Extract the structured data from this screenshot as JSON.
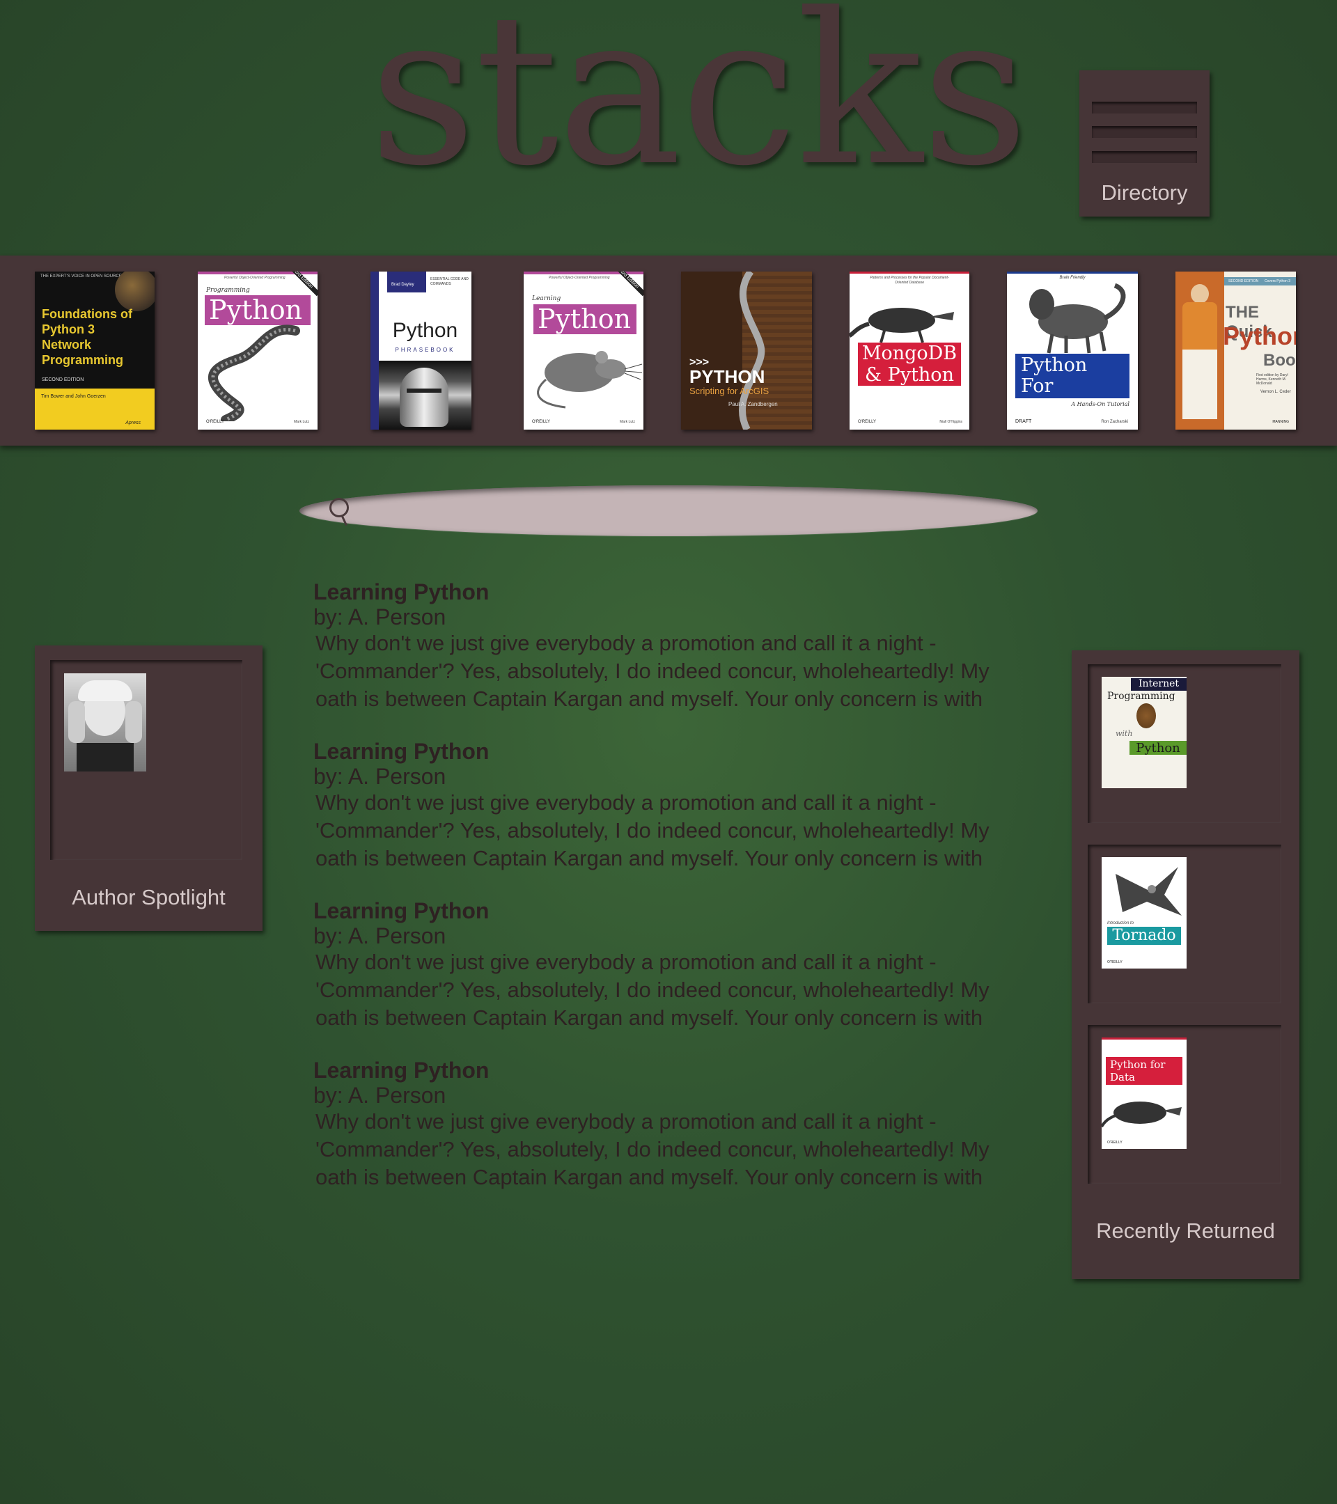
{
  "header": {
    "logo": "stacks",
    "directory_label": "Directory"
  },
  "shelf": {
    "books": [
      {
        "top": "THE EXPERT'S VOICE IN OPEN SOURCE",
        "title": "Foundations of Python 3 Network Programming",
        "edition": "SECOND EDITION",
        "authors": "Tim Bower and John Goerzen",
        "publisher": "Apress"
      },
      {
        "series": "Powerful Object-Oriented Programming",
        "pre": "Programming",
        "title": "Python",
        "badge": "3rd Edition",
        "publisher": "O'REILLY",
        "author": "Mark Lutz"
      },
      {
        "author": "Brad Dayley",
        "tag": "ESSENTIAL CODE AND COMMANDS",
        "title": "Python",
        "subtitle": "PHRASEBOOK"
      },
      {
        "series": "Powerful Object-Oriented Programming",
        "pre": "Learning",
        "title": "Python",
        "badge": "3rd Edition",
        "publisher": "O'REILLY",
        "author": "Mark Lutz"
      },
      {
        "prompt": ">>>",
        "title": "PYTHON",
        "subtitle": "Scripting for ArcGIS",
        "author": "Paul A. Zandbergen"
      },
      {
        "series": "Patterns and Processes for the Popular Document-Oriented Database",
        "title": "MongoDB & Python",
        "publisher": "O'REILLY",
        "author": "Niall O'Higgins"
      },
      {
        "series": "Brain Friendly",
        "title": "Python For Linguists",
        "subtitle": "A Hands-On Tutorial",
        "tag": "DRAFT",
        "author": "Ron Zacharski"
      },
      {
        "series": "SECOND EDITION",
        "series2": "Covers Python 3",
        "pre": "THE Quick",
        "title": "Python",
        "post": "Book",
        "credits": "First edition by Daryl Harms, Kenneth M. McDonald",
        "author": "Vernon L. Ceder",
        "publisher": "MANNING"
      }
    ]
  },
  "search": {
    "placeholder": ""
  },
  "results": [
    {
      "title": "Learning Python",
      "author": "by: A. Person",
      "excerpt": "Why don't we just give everybody a promotion and call it a night - 'Commander'? Yes, absolutely, I do indeed concur, wholeheartedly! My oath is between Captain Kargan and myself. Your only concern is with"
    },
    {
      "title": "Learning Python",
      "author": "by: A. Person",
      "excerpt": "Why don't we just give everybody a promotion and call it a night - 'Commander'? Yes, absolutely, I do indeed concur, wholeheartedly! My oath is between Captain Kargan and myself. Your only concern is with"
    },
    {
      "title": "Learning Python",
      "author": "by: A. Person",
      "excerpt": "Why don't we just give everybody a promotion and call it a night - 'Commander'? Yes, absolutely, I do indeed concur, wholeheartedly! My oath is between Captain Kargan and myself. Your only concern is with"
    },
    {
      "title": "Learning Python",
      "author": "by: A. Person",
      "excerpt": "Why don't we just give everybody a promotion and call it a night - 'Commander'? Yes, absolutely, I do indeed concur, wholeheartedly! My oath is between Captain Kargan and myself. Your only concern is with"
    }
  ],
  "author_spotlight": {
    "label": "Author Spotlight"
  },
  "recently_returned": {
    "label": "Recently Returned",
    "books": [
      {
        "title1": "Internet",
        "title2": "Programming",
        "with": "with",
        "title3": "Python"
      },
      {
        "intro": "Introduction to",
        "title": "Tornado",
        "publisher": "O'REILLY"
      },
      {
        "title": "Python for Data Analysis",
        "publisher": "O'REILLY"
      }
    ]
  },
  "colors": {
    "background": "#2f5230",
    "panel": "#463537",
    "panel_text": "#d6c9c9",
    "search_fill": "#c4b4b6",
    "result_text": "#2e2122"
  }
}
